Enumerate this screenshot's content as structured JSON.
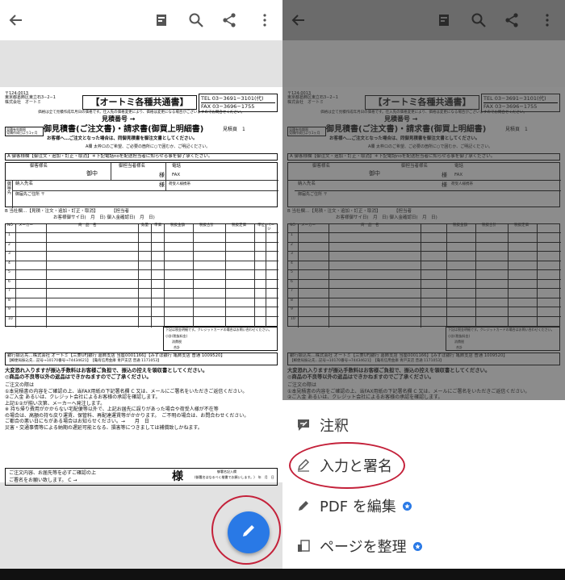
{
  "colors": {
    "accent": "#2979e6",
    "annotation_ring": "#c4213a"
  },
  "toolbar_icons": [
    "back-arrow-icon",
    "layout-icon",
    "search-icon",
    "share-icon",
    "more-vert-icon"
  ],
  "document": {
    "address_lines": [
      "〒124-0013",
      "東京都葛飾区東立石3−2−1",
      "株式会社　オートミ"
    ],
    "title": "【オートミ各種共通書】",
    "tel": "TEL 03−3691−3101(代)",
    "fax": "FAX 03−3696−1755",
    "notice": "価格は全て見積作成年月日の価格です。仕入先の価格変更により、価格は変更になる場合がございますのでお問合せください。",
    "number_label": "見積番号 →",
    "badge": "見積有効期限",
    "badge_sub": "見積作成日より1ヶ月",
    "subtitle": "御見積書(ご注文書)・請求書(御買上明細書)",
    "page_label": "見積頁　1",
    "note1": "お客様へ…ご注文となった場合は、同御見積書を御注文書としてください。",
    "note2": "A欄 太枠ロのご希望、ご必要の箇所に○で囲むか、ご明記ください。",
    "section_a": "A 御客様欄【御注文・追加・訂正・取消】＊下記電話noを配送担当者に知らせる事を御了承ください。",
    "form_a": {
      "customer": "御客様名",
      "onchu": "御中",
      "sama1": "様",
      "sama2": "様",
      "contact": "御担当者様名",
      "phone": "電話",
      "fax": "FAX",
      "recipient": "納入先名",
      "delivery_contact": "荷受人様携帯",
      "delivery_addr": "御届先ご住所 〒",
      "side": "御届先"
    },
    "section_b": "B 当社欄…【見積・注文・追加・訂正・取消】　　　　【担当者",
    "order_row": "お客様御サイ日(　月　日) 御入金確認日(　月　日)",
    "table_headers": [
      "NO",
      "メーカー",
      "商　品　名",
      "数量",
      "単価",
      "税抜金額",
      "税抜合計",
      "税抜定価",
      "単位",
      "ページ"
    ],
    "rows": [
      "1",
      "2",
      "3",
      "4",
      "5",
      "6",
      "7",
      "8",
      "9",
      "10"
    ],
    "totals": [
      "下記は税金明細です。クレジットカードの場合はお問い合わせください。",
      "小計(税抜料金)",
      "消費税",
      "合計"
    ],
    "bank_1": "銀行振込先…株式会社 オートミ【三菱UFJ銀行 葛飾支店 当座0001166】【みずほ銀行 亀飾支店 普通 1009520】",
    "bank_2": "【郵便局振込先…記号→10170番号→74434621】　【亀有信用金庫 青戸支店 普通 1171053】",
    "warn1": "大変恐れ入りますが振込手数料はお客様ご負担で、振込の控えを領収書としてください。",
    "warn2": "◎商品の不良等以外の返品はできかねますのでご了承ください。",
    "fine_lines": [
      "ご注文の際は",
      "①本見積書の内容をご確認の上、当FAX用紙の下記署名欄 C 又は、メールにご署名をいただきご返信ください。",
      "②ご入金 あるいは、クレジット会社によるお客様の承認を確認します。",
      "上記①②が揃い次第、メーカーへ発注します。",
      "※ 持ち帰り費用がかからない宅配便等以外で、上記お届先に誤りがあった場合や荷受人様が不在等",
      "の場合は、高額の持ち戻り運賃、保管料、再配達運賃等がかかります。　ご不明の場合は、お問合わせください。",
      "ご都合の悪い日にちがある場合はお知らせください。→　　月　日",
      "災害・交通事情等による納期の遅延可能となる、損害等につきましては補償致しかねます。"
    ],
    "confirm_1": "ご注文内容、お届先等を必ずご確認の上",
    "confirm_2": "ご署名をお願い致します。 C →",
    "confirm_sama": "様",
    "confirm_right": "(御署名はなるべく楷書でお願いします。)　年　月　日",
    "confirm_right_label": "御署名記入欄"
  },
  "fab_icon": "pencil-icon",
  "sheet": {
    "items": [
      {
        "label": "注釈",
        "icon": "comment-pen-icon",
        "premium": false
      },
      {
        "label": "入力と署名",
        "icon": "signature-pen-icon",
        "premium": false
      },
      {
        "label": "PDF を編集",
        "icon": "pencil-icon",
        "premium": true
      },
      {
        "label": "ページを整理",
        "icon": "organize-pages-icon",
        "premium": true
      }
    ]
  }
}
